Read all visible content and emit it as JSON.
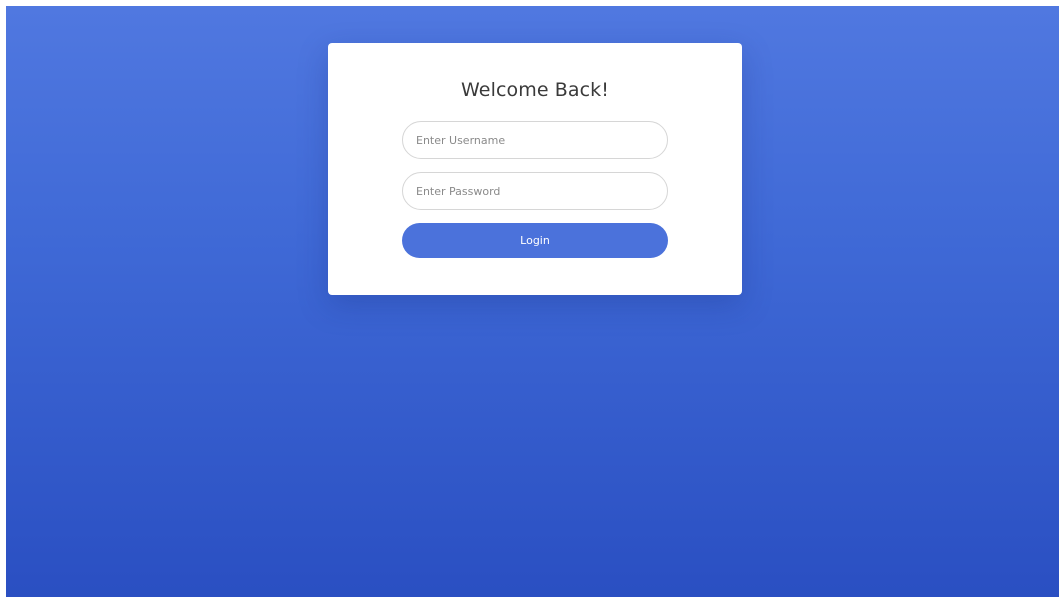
{
  "login": {
    "title": "Welcome Back!",
    "username_placeholder": "Enter Username",
    "username_value": "",
    "password_placeholder": "Enter Password",
    "password_value": "",
    "login_label": "Login"
  },
  "colors": {
    "background_top": "#5078e0",
    "background_bottom": "#2a4fc2",
    "card": "#ffffff",
    "button": "#4b72db",
    "button_text": "#ffffff",
    "title_text": "#3a3a3a"
  }
}
